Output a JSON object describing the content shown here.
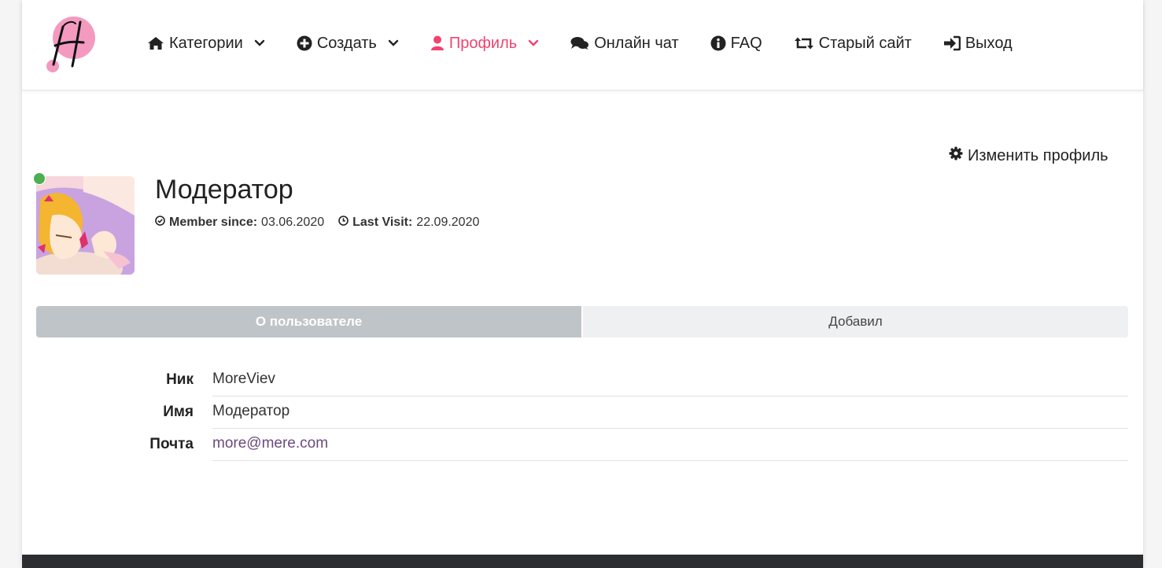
{
  "nav": {
    "items": [
      {
        "label": "Категории",
        "icon": "home-icon",
        "dropdown": true
      },
      {
        "label": "Создать",
        "icon": "plus-circle-icon",
        "dropdown": true
      },
      {
        "label": "Профиль",
        "icon": "user-icon",
        "dropdown": true,
        "active": true
      },
      {
        "label": "Онлайн чат",
        "icon": "comments-icon",
        "dropdown": false
      },
      {
        "label": "FAQ",
        "icon": "info-circle-icon",
        "dropdown": false
      },
      {
        "label": "Старый сайт",
        "icon": "retweet-icon",
        "dropdown": false
      },
      {
        "label": "Выход",
        "icon": "sign-in-icon",
        "dropdown": false
      }
    ]
  },
  "profile": {
    "edit_label": "Изменить профиль",
    "name": "Модератор",
    "member_since_label": "Member since:",
    "member_since": "03.06.2020",
    "last_visit_label": "Last Visit:",
    "last_visit": "22.09.2020"
  },
  "tabs": {
    "about": "О пользователе",
    "added": "Добавил"
  },
  "info": {
    "nick_label": "Ник",
    "nick": "MoreViev",
    "name_label": "Имя",
    "name": "Модератор",
    "email_label": "Почта",
    "email": "more@mere.com"
  },
  "colors": {
    "accent": "#f0436f",
    "online": "#4caf50",
    "tab_active": "#bfc4c8",
    "link": "#6b4a7e"
  }
}
